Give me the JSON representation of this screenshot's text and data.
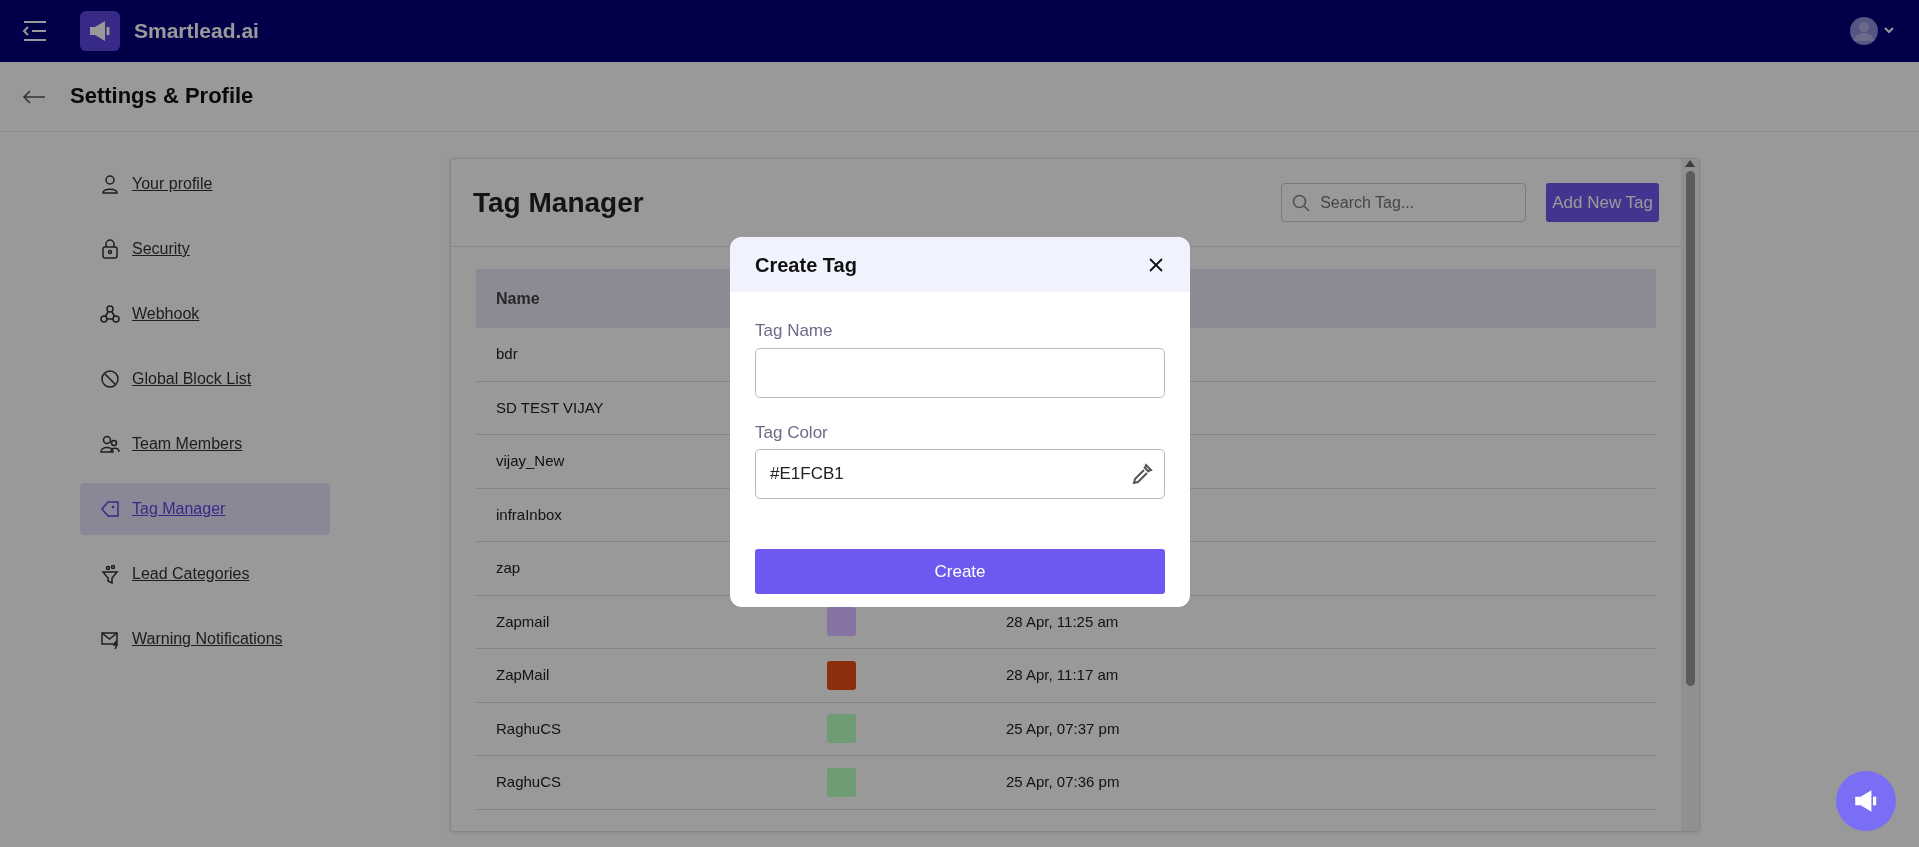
{
  "topbar": {
    "brand": "Smartlead.ai"
  },
  "header": {
    "title": "Settings & Profile"
  },
  "sidebar": {
    "items": [
      {
        "label": "Your profile",
        "selected": false
      },
      {
        "label": "Security",
        "selected": false
      },
      {
        "label": "Webhook",
        "selected": false
      },
      {
        "label": "Global Block List",
        "selected": false
      },
      {
        "label": "Team Members",
        "selected": false
      },
      {
        "label": "Tag Manager",
        "selected": true
      },
      {
        "label": "Lead Categories",
        "selected": false
      },
      {
        "label": "Warning Notifications",
        "selected": false
      }
    ]
  },
  "panel": {
    "title": "Tag Manager",
    "search": {
      "placeholder": "Search Tag..."
    },
    "add_button": "Add New Tag",
    "table": {
      "columns": [
        "Name"
      ],
      "rows": [
        {
          "name": "bdr"
        },
        {
          "name": "SD TEST VIJAY"
        },
        {
          "name": "vijay_New"
        },
        {
          "name": "infraInbox"
        },
        {
          "name": "zap"
        },
        {
          "name": "Zapmail",
          "color": "#8672a3",
          "created": "28 Apr, 11:25 am"
        },
        {
          "name": "ZapMail",
          "color": "#8a2e0e",
          "created": "28 Apr, 11:17 am"
        },
        {
          "name": "RaghuCS",
          "color": "#6e9b73",
          "created": "25 Apr, 07:37 pm"
        },
        {
          "name": "RaghuCS",
          "color": "#6e9b73",
          "created": "25 Apr, 07:36 pm"
        }
      ]
    }
  },
  "modal": {
    "title": "Create Tag",
    "fields": [
      {
        "label": "Tag Name",
        "kind": "text"
      },
      {
        "label": "Tag Color",
        "kind": "color",
        "value": "#E1FCB1"
      }
    ],
    "submit": "Create"
  }
}
